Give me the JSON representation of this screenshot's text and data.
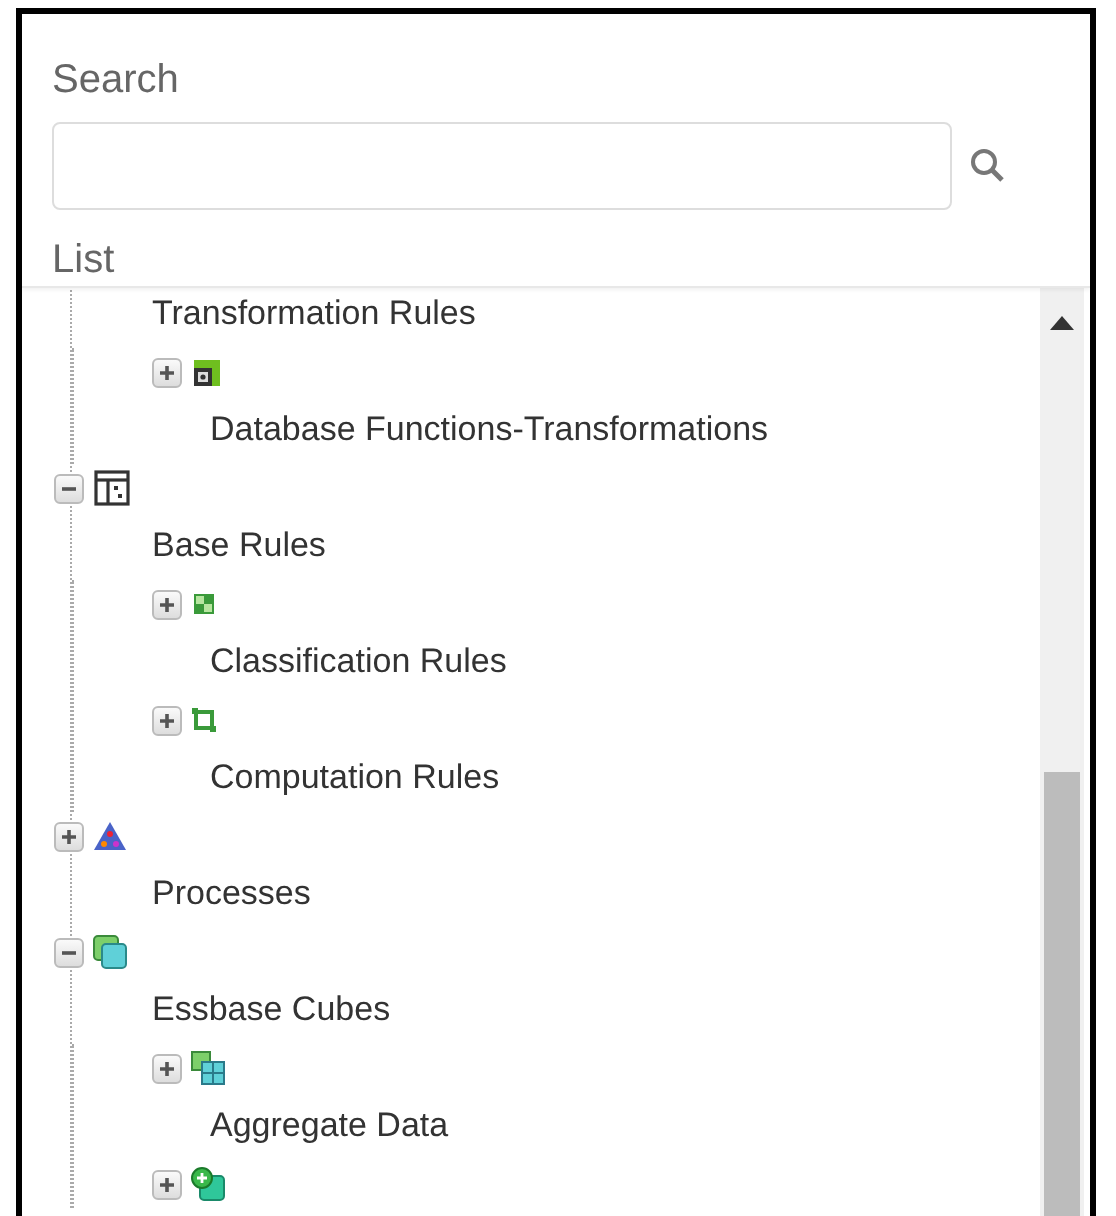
{
  "search": {
    "label": "Search"
  },
  "list": {
    "label": "List",
    "nodes": [
      {
        "label": "Transformation Rules",
        "children": [
          {
            "kind": "transform",
            "expanded": false,
            "label": "Database Functions-Transformations"
          }
        ]
      },
      {
        "kind": "folder",
        "expanded": true,
        "label": "Base Rules",
        "children": [
          {
            "kind": "classification",
            "expanded": false,
            "label": "Classification Rules"
          },
          {
            "kind": "computation",
            "expanded": false,
            "label": "Computation Rules"
          }
        ]
      },
      {
        "kind": "process",
        "expanded": false,
        "label": "Processes"
      },
      {
        "kind": "cube-folder",
        "expanded": true,
        "label": "Essbase Cubes",
        "children": [
          {
            "kind": "cube",
            "expanded": false,
            "label": "Aggregate Data"
          },
          {
            "kind": "cube-new",
            "expanded": false
          }
        ]
      }
    ]
  }
}
